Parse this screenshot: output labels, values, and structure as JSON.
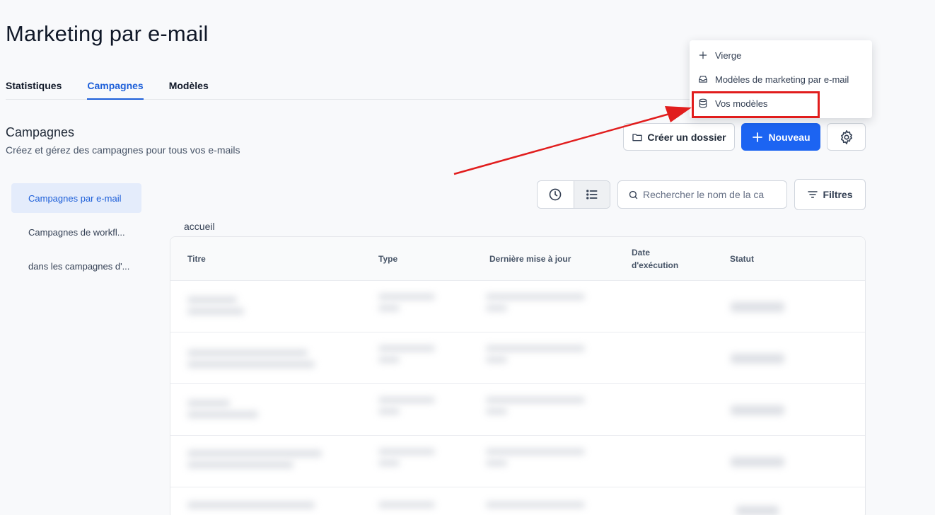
{
  "page": {
    "title": "Marketing par e-mail"
  },
  "tabs": [
    {
      "label": "Statistiques",
      "active": false
    },
    {
      "label": "Campagnes",
      "active": true
    },
    {
      "label": "Modèles",
      "active": false
    }
  ],
  "section": {
    "title": "Campagnes",
    "subtitle": "Créez et gérez des campagnes pour tous vos e-mails"
  },
  "toolbar": {
    "folder_label": "Créer un dossier",
    "new_label": "Nouveau",
    "settings_icon": "gear-icon"
  },
  "dropdown": {
    "items": [
      {
        "label": "Vierge",
        "icon": "plus-icon"
      },
      {
        "label": "Modèles de marketing par e-mail",
        "icon": "inbox-icon"
      },
      {
        "label": "Vos modèles",
        "icon": "database-icon",
        "highlighted": true
      }
    ]
  },
  "sidebar": {
    "items": [
      {
        "label": "Campagnes par e-mail",
        "active": true
      },
      {
        "label": "Campagnes de workfl...",
        "active": false
      },
      {
        "label": "dans les campagnes d'...",
        "active": false
      }
    ]
  },
  "controls": {
    "search_placeholder": "Rechercher le nom de la ca",
    "filter_label": "Filtres"
  },
  "breadcrumb": "accueil",
  "table": {
    "columns": [
      "Titre",
      "Type",
      "Dernière mise à jour",
      "Date\nd'exécution",
      "Statut"
    ]
  },
  "colors": {
    "primary": "#1c64f2",
    "annotation": "#e11d1d"
  }
}
